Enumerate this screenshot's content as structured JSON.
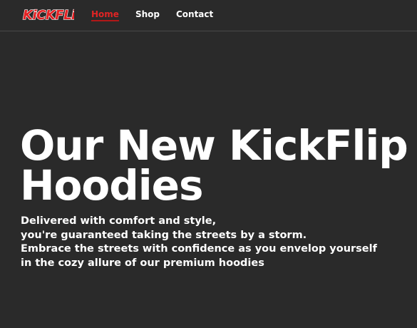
{
  "brand": {
    "logo_text": "KiCKFLiP",
    "logo_color": "#e32224"
  },
  "nav": {
    "items": [
      {
        "label": "Home",
        "active": true
      },
      {
        "label": "Shop",
        "active": false
      },
      {
        "label": "Contact",
        "active": false
      }
    ]
  },
  "hero": {
    "title_lines": [
      "Our New KickFlip",
      "Hoodies"
    ],
    "description_lines": [
      "Delivered with comfort and style,",
      "you're guaranteed taking the streets by a storm.",
      "Embrace the streets with confidence as you envelop yourself",
      "in the cozy allure of our premium hoodies"
    ]
  },
  "colors": {
    "background": "#2a2a2a",
    "text": "#ffffff",
    "accent": "#e02424"
  }
}
